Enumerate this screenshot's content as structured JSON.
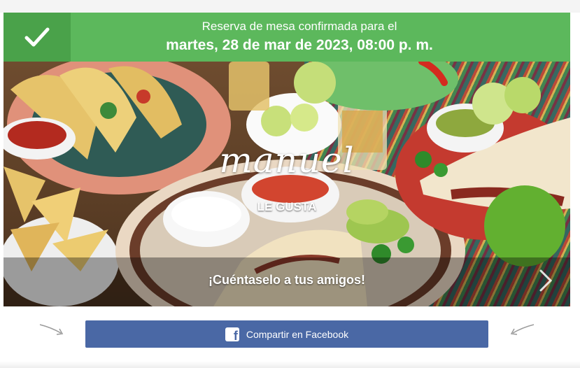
{
  "banner": {
    "line1": "Reserva de mesa confirmada para el",
    "line2": "martes, 28 de mar de 2023, 08:00 p. m.",
    "icon": "checkmark-icon",
    "color": "#5cb85c"
  },
  "photo": {
    "logo_text": "manuel",
    "likes_text": "LE GUSTA",
    "tell_friends": "¡Cuéntaselo a tus amigos!",
    "next_icon": "chevron-right-icon"
  },
  "share": {
    "facebook_label": "Compartir en Facebook",
    "facebook_icon": "facebook-icon",
    "button_color": "#4a68a5"
  }
}
